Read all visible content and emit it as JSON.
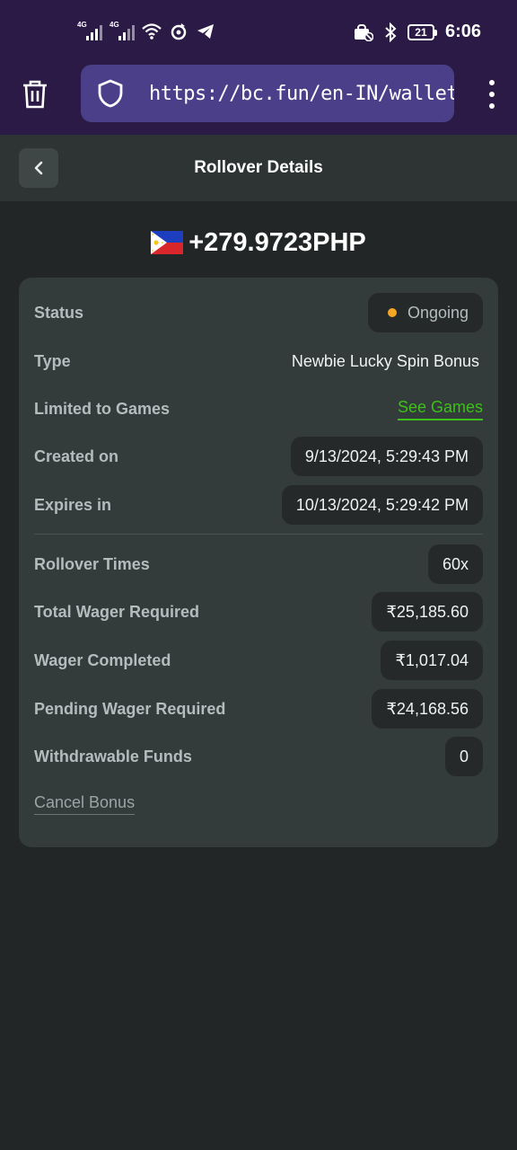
{
  "statusbar": {
    "sim1": "4G",
    "sim2": "4G",
    "battery": "21",
    "time": "6:06"
  },
  "browser": {
    "url": "https://bc.fun/en-IN/wallet/r"
  },
  "header": {
    "title": "Rollover Details"
  },
  "amount": {
    "value": "+279.9723PHP"
  },
  "details": {
    "status_label": "Status",
    "status_value": "Ongoing",
    "type_label": "Type",
    "type_value": "Newbie Lucky Spin Bonus",
    "games_label": "Limited to Games",
    "games_link": "See Games",
    "created_label": "Created on",
    "created_value": "9/13/2024, 5:29:43 PM",
    "expires_label": "Expires in",
    "expires_value": "10/13/2024, 5:29:42 PM",
    "rollover_label": "Rollover Times",
    "rollover_value": "60x",
    "total_label": "Total Wager Required",
    "total_value": "₹25,185.60",
    "completed_label": "Wager Completed",
    "completed_value": "₹1,017.04",
    "pending_label": "Pending Wager Required",
    "pending_value": "₹24,168.56",
    "withdrawable_label": "Withdrawable Funds",
    "withdrawable_value": "0",
    "cancel_label": "Cancel Bonus"
  },
  "colors": {
    "accent_green": "#3bc117",
    "status_dot": "#f5a623",
    "browser_bar": "#2b1a45",
    "url_field": "#4a3f88"
  }
}
